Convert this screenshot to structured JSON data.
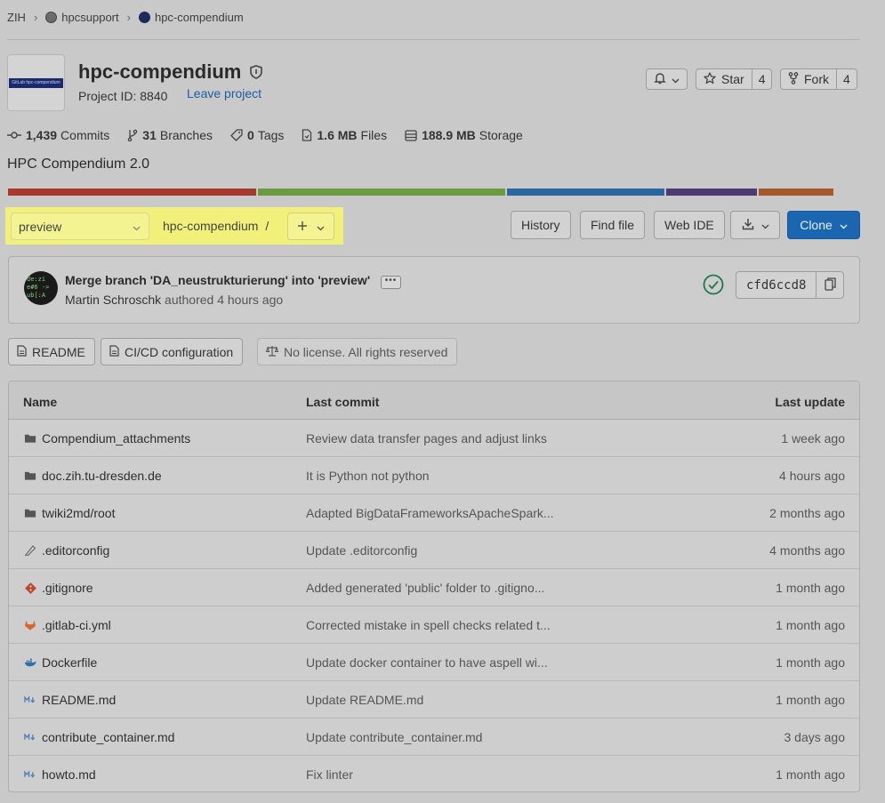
{
  "breadcrumb": {
    "items": [
      "ZIH",
      "hpcsupport",
      "hpc-compendium"
    ],
    "separator": "›"
  },
  "project": {
    "name": "hpc-compendium",
    "id_label": "Project ID: 8840",
    "leave_label": "Leave project",
    "avatar_text": "GitLab hpc-compendium",
    "description": "HPC Compendium 2.0"
  },
  "actions": {
    "star_label": "Star",
    "star_count": "4",
    "fork_label": "Fork",
    "fork_count": "4"
  },
  "stats": {
    "commits_value": "1,439",
    "commits_label": "Commits",
    "branches_value": "31",
    "branches_label": "Branches",
    "tags_value": "0",
    "tags_label": "Tags",
    "files_value": "1.6 MB",
    "files_label": "Files",
    "storage_value": "188.9 MB",
    "storage_label": "Storage"
  },
  "language_bar": [
    {
      "color": "#a63a2e",
      "fraction": 0.3
    },
    {
      "color": "#6a9a41",
      "fraction": 0.3
    },
    {
      "color": "#2c66a0",
      "fraction": 0.19
    },
    {
      "color": "#4b3a74",
      "fraction": 0.11
    },
    {
      "color": "#a5582c",
      "fraction": 0.09
    }
  ],
  "repo_nav": {
    "branch": "preview",
    "path": "hpc-compendium",
    "path_sep": "/",
    "history_label": "History",
    "find_file_label": "Find file",
    "web_ide_label": "Web IDE",
    "clone_label": "Clone"
  },
  "last_commit": {
    "title": "Merge branch 'DA_neustrukturierung' into 'preview'",
    "more": "•••",
    "author": "Martin Schroschk",
    "authored_text": "authored 4 hours ago",
    "sha": "cfd6ccd8",
    "avatar_lines": [
      "de:zi",
      "e#6 ->",
      "ub[:A"
    ]
  },
  "pills": {
    "readme": "README",
    "cicd": "CI/CD configuration",
    "license": "No license. All rights reserved"
  },
  "table": {
    "headers": {
      "name": "Name",
      "last_commit": "Last commit",
      "last_update": "Last update"
    },
    "rows": [
      {
        "icon": "folder-icon",
        "name": "Compendium_attachments",
        "msg": "Review data transfer pages and adjust links",
        "updated": "1 week ago"
      },
      {
        "icon": "folder-icon",
        "name": "doc.zih.tu-dresden.de",
        "msg": "It is Python not python",
        "updated": "4 hours ago"
      },
      {
        "icon": "folder-icon",
        "name": "twiki2md/root",
        "msg": "Adapted BigDataFrameworksApacheSpark...",
        "updated": "2 months ago"
      },
      {
        "icon": "editorconfig-icon",
        "name": ".editorconfig",
        "msg": "Update .editorconfig",
        "updated": "4 months ago"
      },
      {
        "icon": "git-icon",
        "name": ".gitignore",
        "msg": "Added generated 'public' folder to .gitigno...",
        "updated": "1 month ago"
      },
      {
        "icon": "gitlab-icon",
        "name": ".gitlab-ci.yml",
        "msg": "Corrected mistake in spell checks related t...",
        "updated": "1 month ago"
      },
      {
        "icon": "docker-icon",
        "name": "Dockerfile",
        "msg": "Update docker container to have aspell wi...",
        "updated": "1 month ago"
      },
      {
        "icon": "markdown-icon",
        "name": "README.md",
        "msg": "Update README.md",
        "updated": "1 month ago"
      },
      {
        "icon": "markdown-icon",
        "name": "contribute_container.md",
        "msg": "Update contribute_container.md",
        "updated": "3 days ago"
      },
      {
        "icon": "markdown-icon",
        "name": "howto.md",
        "msg": "Fix linter",
        "updated": "1 month ago"
      }
    ]
  },
  "colors": {
    "highlight": "#f0f07a",
    "clone_button": "#1b66b1",
    "link": "#1f5ba5",
    "pipeline_success": "#1e7a4a"
  }
}
